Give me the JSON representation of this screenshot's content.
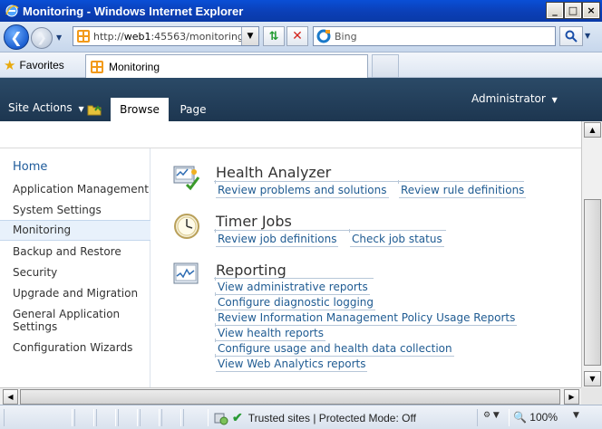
{
  "window": {
    "title": "Monitoring - Windows Internet Explorer",
    "min_glyph": "_",
    "max_glyph": "□",
    "close_glyph": "×"
  },
  "address_bar": {
    "url_prefix": "http://",
    "url_host": "web1",
    "url_rest": ":45563/monitoring.",
    "search_placeholder": "Bing"
  },
  "favorites_bar": {
    "favorites_label": "Favorites",
    "tab_title": "Monitoring"
  },
  "ribbon": {
    "site_actions": "Site Actions",
    "tabs": [
      "Browse",
      "Page"
    ],
    "user": "Administrator"
  },
  "quick_launch": {
    "items": [
      "Home",
      "Application Management",
      "System Settings",
      "Monitoring",
      "Backup and Restore",
      "Security",
      "Upgrade and Migration",
      "General Application",
      "Settings",
      "Configuration Wizards"
    ],
    "selected": "Monitoring"
  },
  "sections": [
    {
      "title": "Health Analyzer",
      "icon": "health-analyzer-icon",
      "links": [
        "Review problems and solutions",
        "Review rule definitions"
      ]
    },
    {
      "title": "Timer Jobs",
      "icon": "timer-clock-icon",
      "links": [
        "Review job definitions",
        "Check job status"
      ]
    },
    {
      "title": "Reporting",
      "icon": "reporting-chart-icon",
      "links": [
        "View administrative reports",
        "Configure diagnostic logging",
        "Review Information Management Policy Usage Reports",
        "View health reports",
        "Configure usage and health data collection",
        "View Web Analytics reports"
      ]
    }
  ],
  "status_bar": {
    "zone": "Trusted sites | Protected Mode: Off",
    "zoom": "100%"
  },
  "colors": {
    "ribbon": "#1d3650",
    "link": "#1f5b92",
    "title_bar": "#0b3fb6"
  }
}
